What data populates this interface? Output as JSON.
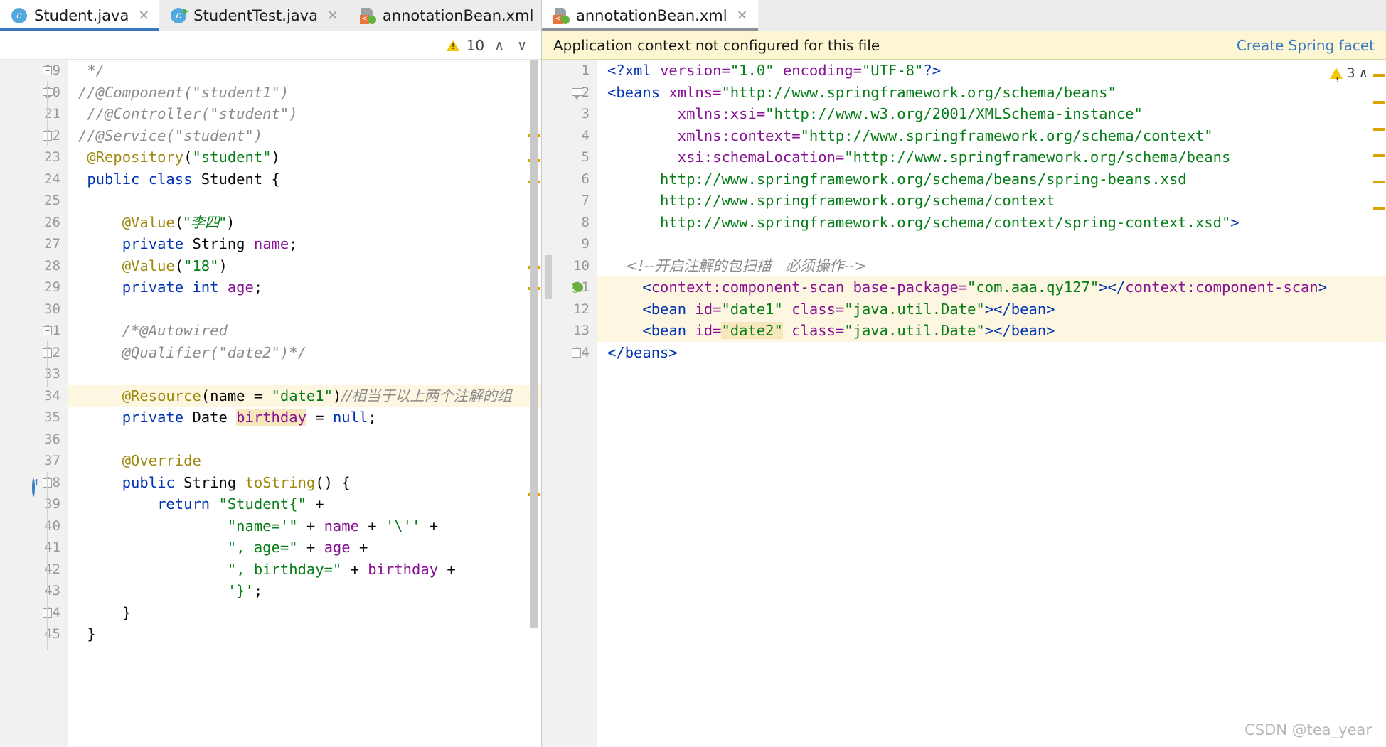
{
  "left_pane": {
    "tabs": [
      {
        "label": "Student.java",
        "icon": "java-class-icon",
        "active": true,
        "closable": true
      },
      {
        "label": "StudentTest.java",
        "icon": "java-runnable-class-icon",
        "active": false,
        "closable": true
      },
      {
        "label": "annotationBean.xml",
        "icon": "spring-xml-icon",
        "active": false,
        "closable": true
      }
    ],
    "inspection": {
      "warning_count": "10",
      "prev_label": "∧",
      "next_label": "∨"
    },
    "first_line_number": 19,
    "lines": [
      {
        "n": 19,
        "fold": "square",
        "tokens": [
          {
            "t": " */",
            "c": "cmt"
          }
        ]
      },
      {
        "n": 20,
        "fold": "arrow",
        "tokens": [
          {
            "t": "//@Component(\"student1\")",
            "c": "cmt"
          }
        ]
      },
      {
        "n": 21,
        "fold": "",
        "tokens": [
          {
            "t": " //@Controller(\"student\")",
            "c": "cmt"
          }
        ]
      },
      {
        "n": 22,
        "fold": "square",
        "tokens": [
          {
            "t": "//@Service(\"student\")",
            "c": "cmt"
          }
        ]
      },
      {
        "n": 23,
        "fold": "",
        "tokens": [
          {
            "t": " @Repository",
            "c": "ann"
          },
          {
            "t": "(",
            "c": "pln"
          },
          {
            "t": "\"student\"",
            "c": "str"
          },
          {
            "t": ")",
            "c": "pln"
          }
        ]
      },
      {
        "n": 24,
        "fold": "",
        "tokens": [
          {
            "t": " public class ",
            "c": "kw"
          },
          {
            "t": "Student {",
            "c": "pln"
          }
        ]
      },
      {
        "n": 25,
        "fold": "",
        "tokens": []
      },
      {
        "n": 26,
        "fold": "",
        "tokens": [
          {
            "t": "     @Value",
            "c": "ann"
          },
          {
            "t": "(",
            "c": "pln"
          },
          {
            "t": "\"李四\"",
            "c": "str"
          },
          {
            "t": ")",
            "c": "pln"
          }
        ]
      },
      {
        "n": 27,
        "fold": "",
        "tokens": [
          {
            "t": "     private ",
            "c": "kw"
          },
          {
            "t": "String ",
            "c": "pln"
          },
          {
            "t": "name",
            "c": "fld"
          },
          {
            "t": ";",
            "c": "pln"
          }
        ]
      },
      {
        "n": 28,
        "fold": "",
        "tokens": [
          {
            "t": "     @Value",
            "c": "ann"
          },
          {
            "t": "(",
            "c": "pln"
          },
          {
            "t": "\"18\"",
            "c": "str"
          },
          {
            "t": ")",
            "c": "pln"
          }
        ]
      },
      {
        "n": 29,
        "fold": "",
        "tokens": [
          {
            "t": "     private int ",
            "c": "kw"
          },
          {
            "t": "age",
            "c": "fld"
          },
          {
            "t": ";",
            "c": "pln"
          }
        ]
      },
      {
        "n": 30,
        "fold": "",
        "tokens": []
      },
      {
        "n": 31,
        "fold": "square",
        "tokens": [
          {
            "t": "     /*@Autowired",
            "c": "cmt"
          }
        ]
      },
      {
        "n": 32,
        "fold": "square",
        "tokens": [
          {
            "t": "     @Qualifier(\"date2\")*/",
            "c": "cmt"
          }
        ]
      },
      {
        "n": 33,
        "fold": "",
        "tokens": []
      },
      {
        "n": 34,
        "fold": "",
        "hl": true,
        "tokens": [
          {
            "t": "     @Resource",
            "c": "ann"
          },
          {
            "t": "(name = ",
            "c": "pln"
          },
          {
            "t": "\"date1\"",
            "c": "str"
          },
          {
            "t": ")",
            "c": "pln"
          },
          {
            "t": "//相当于以上两个注解的组",
            "c": "cmt"
          }
        ]
      },
      {
        "n": 35,
        "fold": "",
        "tokens": [
          {
            "t": "     private ",
            "c": "kw"
          },
          {
            "t": "Date ",
            "c": "pln"
          },
          {
            "t": "birthday",
            "c": "fld mark"
          },
          {
            "t": " = ",
            "c": "pln"
          },
          {
            "t": "null",
            "c": "kw"
          },
          {
            "t": ";",
            "c": "pln"
          }
        ]
      },
      {
        "n": 36,
        "fold": "",
        "tokens": []
      },
      {
        "n": 37,
        "fold": "",
        "tokens": [
          {
            "t": "     @Override",
            "c": "ann"
          }
        ]
      },
      {
        "n": 38,
        "fold": "square",
        "runmark": true,
        "tokens": [
          {
            "t": "     public ",
            "c": "kw"
          },
          {
            "t": "String ",
            "c": "pln"
          },
          {
            "t": "toString",
            "c": "ann"
          },
          {
            "t": "() {",
            "c": "pln"
          }
        ]
      },
      {
        "n": 39,
        "fold": "",
        "tokens": [
          {
            "t": "         return ",
            "c": "kw"
          },
          {
            "t": "\"Student{\"",
            "c": "str"
          },
          {
            "t": " +",
            "c": "pln"
          }
        ]
      },
      {
        "n": 40,
        "fold": "",
        "tokens": [
          {
            "t": "                 \"name='\"",
            "c": "str"
          },
          {
            "t": " + ",
            "c": "pln"
          },
          {
            "t": "name",
            "c": "fld"
          },
          {
            "t": " + ",
            "c": "pln"
          },
          {
            "t": "'\\''",
            "c": "str"
          },
          {
            "t": " +",
            "c": "pln"
          }
        ]
      },
      {
        "n": 41,
        "fold": "",
        "tokens": [
          {
            "t": "                 \", age=\"",
            "c": "str"
          },
          {
            "t": " + ",
            "c": "pln"
          },
          {
            "t": "age",
            "c": "fld"
          },
          {
            "t": " +",
            "c": "pln"
          }
        ]
      },
      {
        "n": 42,
        "fold": "",
        "tokens": [
          {
            "t": "                 \", birthday=\"",
            "c": "str"
          },
          {
            "t": " + ",
            "c": "pln"
          },
          {
            "t": "birthday",
            "c": "fld"
          },
          {
            "t": " +",
            "c": "pln"
          }
        ]
      },
      {
        "n": 43,
        "fold": "",
        "tokens": [
          {
            "t": "                 '}'",
            "c": "str"
          },
          {
            "t": ";",
            "c": "pln"
          }
        ]
      },
      {
        "n": 44,
        "fold": "square",
        "tokens": [
          {
            "t": "     }",
            "c": "pln"
          }
        ]
      },
      {
        "n": 45,
        "fold": "",
        "tokens": [
          {
            "t": " }",
            "c": "pln"
          }
        ]
      }
    ],
    "marker_ticks_y": [
      105,
      140,
      170,
      290,
      320,
      610
    ]
  },
  "right_pane": {
    "tabs": [
      {
        "label": "annotationBean.xml",
        "icon": "spring-xml-icon",
        "active": true,
        "closable": true
      }
    ],
    "notification": {
      "message": "Application context not configured for this file",
      "action_label": "Create Spring facet"
    },
    "inspection": {
      "error_count": "3",
      "chevron": "∧"
    },
    "lines": [
      {
        "n": 1,
        "fold": "",
        "tokens": [
          {
            "t": "<?",
            "c": "tag"
          },
          {
            "t": "xml ",
            "c": "tag"
          },
          {
            "t": "version=",
            "c": "attr"
          },
          {
            "t": "\"1.0\"",
            "c": "str"
          },
          {
            "t": " ",
            "c": "pln"
          },
          {
            "t": "encoding=",
            "c": "attr"
          },
          {
            "t": "\"UTF-8\"",
            "c": "str"
          },
          {
            "t": "?>",
            "c": "tag"
          }
        ]
      },
      {
        "n": 2,
        "fold": "arrow",
        "tokens": [
          {
            "t": "<beans ",
            "c": "tag"
          },
          {
            "t": "xmlns=",
            "c": "attr"
          },
          {
            "t": "\"http://www.springframework.org/schema/beans\"",
            "c": "str"
          }
        ]
      },
      {
        "n": 3,
        "fold": "",
        "tokens": [
          {
            "t": "        ",
            "c": "pln"
          },
          {
            "t": "xmlns:xsi=",
            "c": "attr"
          },
          {
            "t": "\"http://www.w3.org/2001/XMLSchema-instance\"",
            "c": "str"
          }
        ]
      },
      {
        "n": 4,
        "fold": "",
        "tokens": [
          {
            "t": "        ",
            "c": "pln"
          },
          {
            "t": "xmlns:context=",
            "c": "attr"
          },
          {
            "t": "\"http://www.springframework.org/schema/context\"",
            "c": "str"
          }
        ]
      },
      {
        "n": 5,
        "fold": "",
        "tokens": [
          {
            "t": "        ",
            "c": "pln"
          },
          {
            "t": "xsi:schemaLocation=",
            "c": "attr"
          },
          {
            "t": "\"http://www.springframework.org/schema/beans",
            "c": "str"
          }
        ]
      },
      {
        "n": 6,
        "fold": "",
        "tokens": [
          {
            "t": "      http://www.springframework.org/schema/beans/spring-beans.xsd",
            "c": "str"
          }
        ]
      },
      {
        "n": 7,
        "fold": "",
        "tokens": [
          {
            "t": "      http://www.springframework.org/schema/context",
            "c": "str"
          }
        ]
      },
      {
        "n": 8,
        "fold": "",
        "tokens": [
          {
            "t": "      http://www.springframework.org/schema/context/spring-context.xsd\"",
            "c": "str"
          },
          {
            "t": ">",
            "c": "tag"
          }
        ]
      },
      {
        "n": 9,
        "fold": "",
        "tokens": []
      },
      {
        "n": 10,
        "fold": "",
        "tokens": [
          {
            "t": "    <!--开启注解的包扫描　必须操作-->",
            "c": "xcmt"
          }
        ]
      },
      {
        "n": 11,
        "fold": "",
        "hl": true,
        "spring": true,
        "tokens": [
          {
            "t": "    <",
            "c": "tag"
          },
          {
            "t": "context:component-scan ",
            "c": "attr"
          },
          {
            "t": "base-package=",
            "c": "attr"
          },
          {
            "t": "\"com.aaa.qy127\"",
            "c": "str"
          },
          {
            "t": "></",
            "c": "tag"
          },
          {
            "t": "context:component-scan",
            "c": "attr"
          },
          {
            "t": ">",
            "c": "tag"
          }
        ]
      },
      {
        "n": 12,
        "fold": "",
        "hl": true,
        "tokens": [
          {
            "t": "    <",
            "c": "tag"
          },
          {
            "t": "bean ",
            "c": "tag"
          },
          {
            "t": "id=",
            "c": "attr"
          },
          {
            "t": "\"date1\"",
            "c": "str"
          },
          {
            "t": " ",
            "c": "pln"
          },
          {
            "t": "class=",
            "c": "attr"
          },
          {
            "t": "\"java.util.Date\"",
            "c": "str"
          },
          {
            "t": "></",
            "c": "tag"
          },
          {
            "t": "bean",
            "c": "tag"
          },
          {
            "t": ">",
            "c": "tag"
          }
        ]
      },
      {
        "n": 13,
        "fold": "",
        "hl": true,
        "hl2": true,
        "tokens": [
          {
            "t": "    <",
            "c": "tag"
          },
          {
            "t": "bean ",
            "c": "tag"
          },
          {
            "t": "id=",
            "c": "attr"
          },
          {
            "t": "\"date2\"",
            "c": "str mark"
          },
          {
            "t": " ",
            "c": "pln"
          },
          {
            "t": "class=",
            "c": "attr"
          },
          {
            "t": "\"java.util.Date\"",
            "c": "str"
          },
          {
            "t": "></",
            "c": "tag"
          },
          {
            "t": "bean",
            "c": "tag"
          },
          {
            "t": ">",
            "c": "tag"
          }
        ]
      },
      {
        "n": 14,
        "fold": "square",
        "tokens": [
          {
            "t": "</",
            "c": "tag"
          },
          {
            "t": "beans",
            "c": "tag"
          },
          {
            "t": ">",
            "c": "tag"
          }
        ]
      }
    ],
    "marker_ticks_y": [
      20,
      58,
      96,
      133,
      170,
      207
    ]
  },
  "watermark": "CSDN @tea_year"
}
